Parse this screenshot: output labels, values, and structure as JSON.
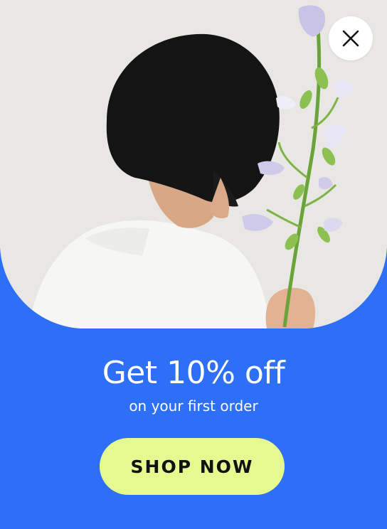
{
  "hero": {
    "image": "person-with-bellflowers-photo"
  },
  "close_button": {
    "icon": "close-icon"
  },
  "offer": {
    "headline": "Get 10% off",
    "subline": "on your first order"
  },
  "cta": {
    "label": "SHOP NOW"
  },
  "colors": {
    "background": "#2d6ff6",
    "cta_background": "#e4f98f",
    "cta_text": "#111111",
    "text": "#ffffff",
    "close_background": "#ffffff"
  }
}
